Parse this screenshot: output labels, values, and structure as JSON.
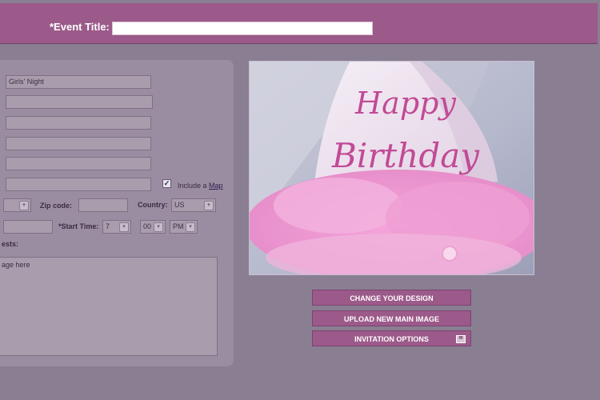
{
  "header": {
    "event_title_label": "*Event Title:",
    "event_title_value": ""
  },
  "form": {
    "name_value": "Girls' Night",
    "include_map_prefix": "Include a",
    "include_map_link": "Map",
    "zip_label": "Zip code:",
    "country_label": "Country:",
    "country_value": "US",
    "start_time_label": "*Start Time:",
    "hour_value": "7",
    "minute_value": "00",
    "ampm_value": "PM",
    "guests_label_fragment": "ests:",
    "message_fragment": "age here"
  },
  "photo": {
    "hat_text_line1": "Happy",
    "hat_text_line2": "Birthday"
  },
  "buttons": {
    "change_design": "CHANGE YOUR DESIGN",
    "upload_image": "UPLOAD NEW MAIN IMAGE",
    "invitation_options": "INVITATION OPTIONS"
  },
  "colors": {
    "accent": "#9b5a8a",
    "background": "#8a7e93",
    "panel": "#9a8ca1"
  }
}
